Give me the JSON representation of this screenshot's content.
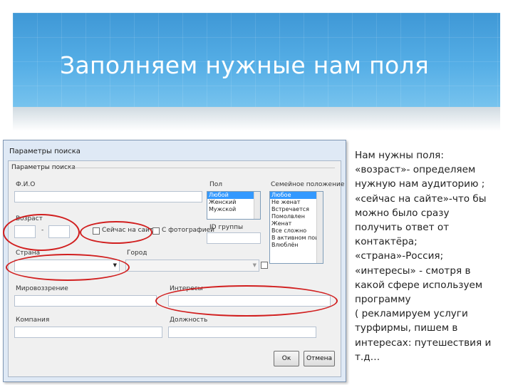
{
  "slide": {
    "title": "Заполняем нужные нам поля"
  },
  "dialog": {
    "window_title": "Параметры поиска",
    "group_title": "Параметры поиска",
    "fields": {
      "name_label": "Ф.И.О",
      "age_label": "Возраст",
      "age_dash": "-",
      "online_label": "Сейчас на сайте",
      "photo_label": "С фотографией",
      "country_label": "Страна",
      "city_label": "Город",
      "worldview_label": "Мировоззрение",
      "interests_label": "Интересы",
      "company_label": "Компания",
      "position_label": "Должность",
      "gender_label": "Пол",
      "id_label": "ID группы",
      "marital_label": "Семейное положение"
    },
    "gender_options": [
      "Любой",
      "Женский",
      "Мужской"
    ],
    "marital_options": [
      "Любое",
      "Не женат",
      "Встречается",
      "Помолвлен",
      "Женат",
      "Все сложно",
      "В активном поиске",
      "Влюблён"
    ],
    "buttons": {
      "ok": "Ок",
      "cancel": "Отмена"
    }
  },
  "notes": {
    "lines": [
      "Нам нужны поля:",
      "«возраст»- определяем",
      "нужную нам аудиторию ;",
      "«сейчас на сайте»-что бы",
      "можно было сразу",
      "получить ответ от",
      "контактёра;",
      "«страна»-Россия;",
      "«интересы» - смотря в",
      "какой сфере используем",
      "программу",
      "( рекламируем услуги",
      "турфирмы, пишем в",
      "интересах: путешествия и",
      "т.д…"
    ]
  },
  "colors": {
    "annotation_red": "#d11f1f",
    "header_blue": "#4aa6e2",
    "list_selection": "#3399ff"
  }
}
